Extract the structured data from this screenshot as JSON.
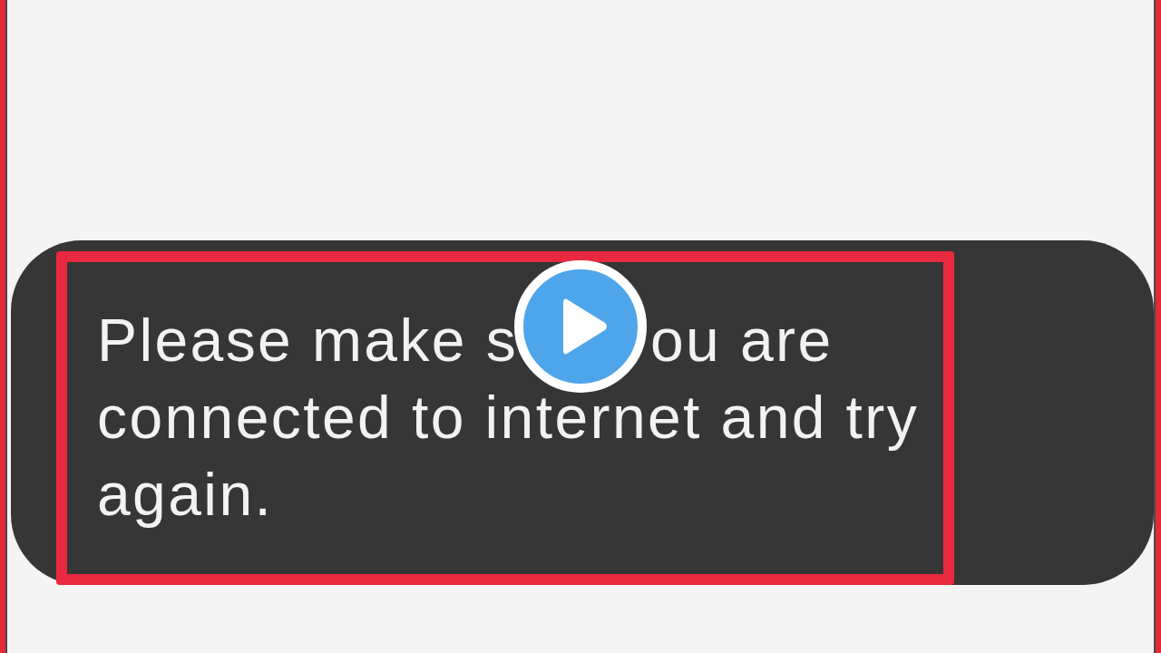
{
  "toast": {
    "highlighted": true,
    "lines": [
      {
        "segments": [
          "Please make s",
          "ou are"
        ]
      },
      {
        "segments": [
          "connected to internet and try"
        ]
      },
      {
        "segments": [
          "again."
        ]
      }
    ]
  }
}
